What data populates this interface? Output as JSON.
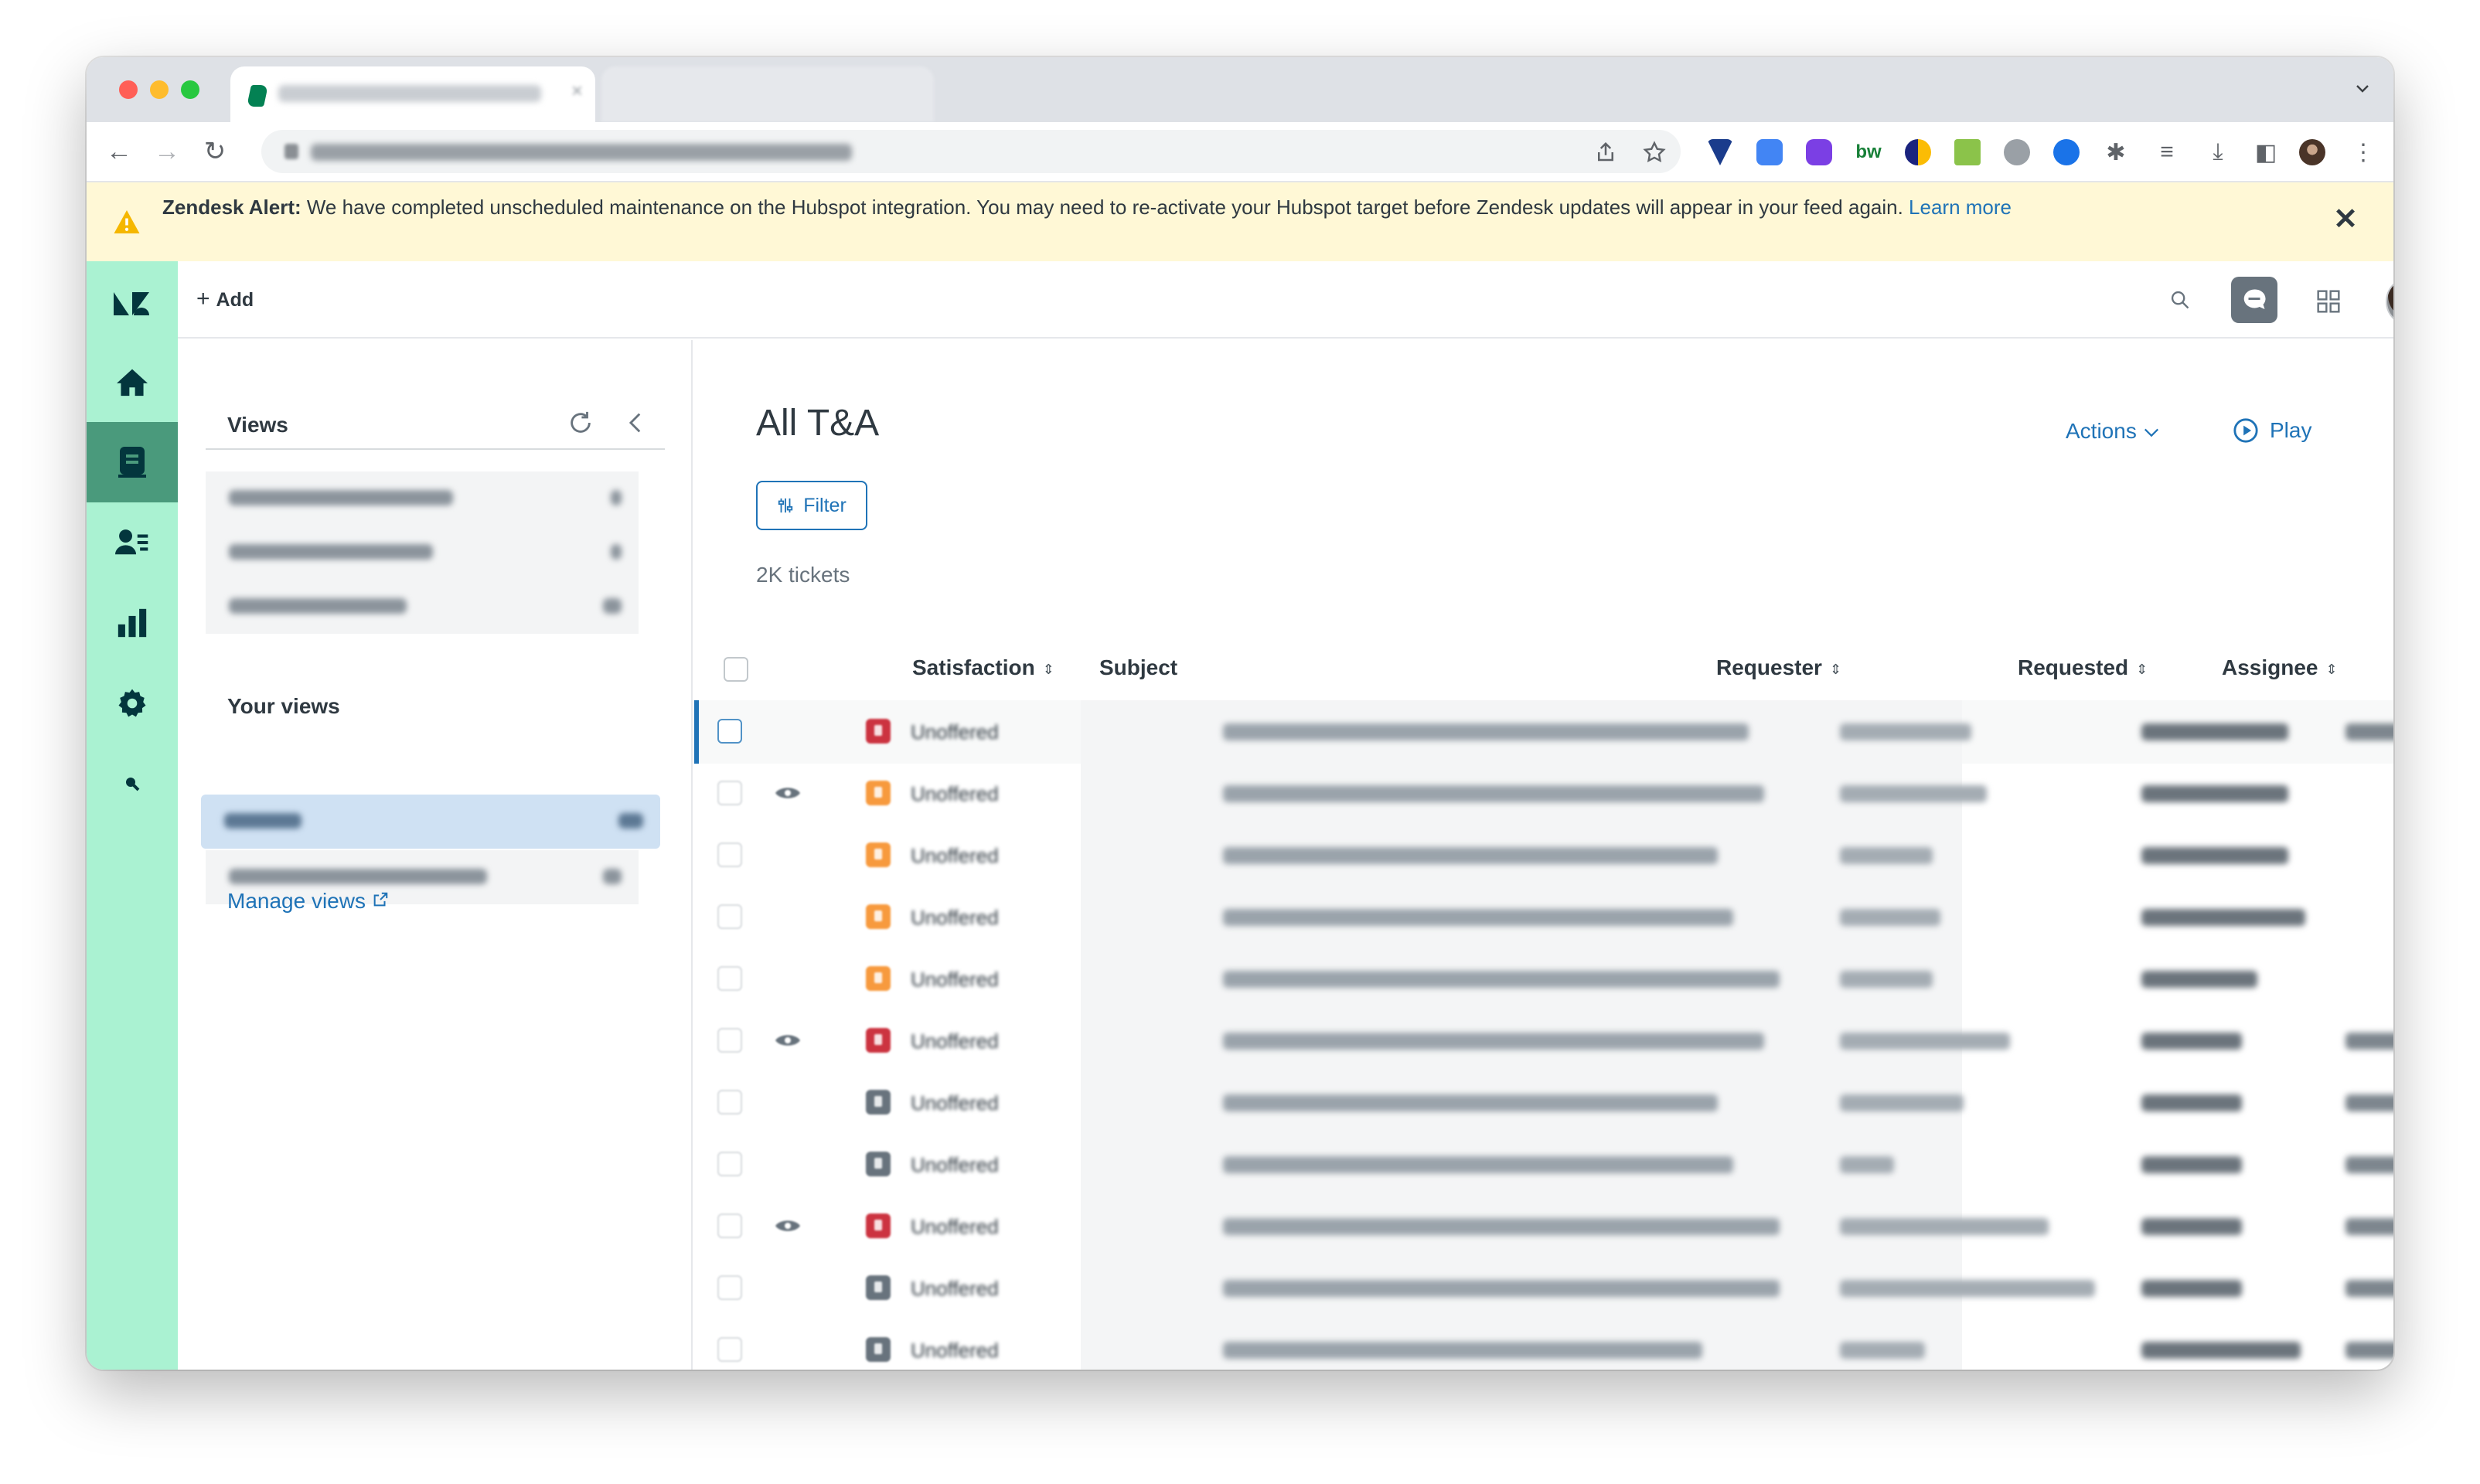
{
  "colors": {
    "brand_green": "#aaf2d2",
    "rail_active": "#4a9a7c",
    "link_blue": "#1f73b7",
    "alert_bg": "#fff8d6",
    "priority_urgent": "#cc3340",
    "priority_high": "#f79a3e",
    "priority_normal": "#68737d"
  },
  "alert": {
    "title": "Zendesk Alert:",
    "message": " We have completed unscheduled maintenance on the Hubspot integration. You may need to re-activate your Hubspot target before Zendesk updates will appear in your feed again. ",
    "link": "Learn more",
    "close_icon": "close-icon"
  },
  "topbar": {
    "add_label": "Add"
  },
  "sidebar": {
    "title": "Views",
    "your_views_title": "Your views",
    "manage_views": "Manage views"
  },
  "main": {
    "title": "All T&A",
    "actions_label": "Actions",
    "play_label": "Play",
    "filter_label": "Filter",
    "ticket_count": "2K tickets",
    "columns": {
      "satisfaction": "Satisfaction",
      "subject": "Subject",
      "requester": "Requester",
      "requested": "Requested",
      "assignee": "Assignee"
    }
  },
  "rows": [
    {
      "priority": "urgent",
      "viewing": false,
      "satisfaction": "Unoffered"
    },
    {
      "priority": "high",
      "viewing": true,
      "satisfaction": "Unoffered"
    },
    {
      "priority": "high",
      "viewing": false,
      "satisfaction": "Unoffered"
    },
    {
      "priority": "high",
      "viewing": false,
      "satisfaction": "Unoffered"
    },
    {
      "priority": "high",
      "viewing": false,
      "satisfaction": "Unoffered"
    },
    {
      "priority": "urgent",
      "viewing": true,
      "satisfaction": "Unoffered"
    },
    {
      "priority": "normal",
      "viewing": false,
      "satisfaction": "Unoffered"
    },
    {
      "priority": "normal",
      "viewing": false,
      "satisfaction": "Unoffered"
    },
    {
      "priority": "urgent",
      "viewing": true,
      "satisfaction": "Unoffered"
    },
    {
      "priority": "normal",
      "viewing": false,
      "satisfaction": "Unoffered"
    },
    {
      "priority": "normal",
      "viewing": false,
      "satisfaction": "Unoffered"
    }
  ]
}
